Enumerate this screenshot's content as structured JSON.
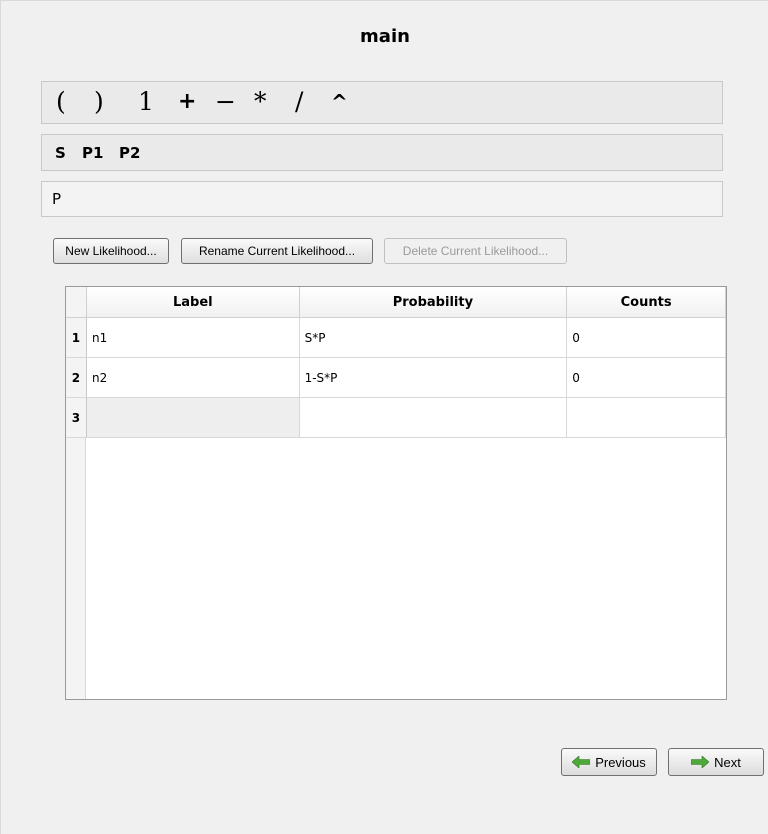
{
  "title": "main",
  "operators": [
    "(",
    ")",
    "1",
    "+",
    "−",
    "*",
    "/",
    "^"
  ],
  "parameters": [
    "S",
    "P1",
    "P2"
  ],
  "expression": "P",
  "buttons": {
    "new_likelihood": "New Likelihood...",
    "rename_likelihood": "Rename Current Likelihood...",
    "delete_likelihood": "Delete Current Likelihood..."
  },
  "table": {
    "headers": [
      "Label",
      "Probability",
      "Counts"
    ],
    "rows": [
      {
        "num": "1",
        "label": "n1",
        "probability": "S*P",
        "counts": "0"
      },
      {
        "num": "2",
        "label": "n2",
        "probability": "1-S*P",
        "counts": "0"
      },
      {
        "num": "3",
        "label": "",
        "probability": "",
        "counts": ""
      }
    ]
  },
  "nav": {
    "previous": "Previous",
    "next": "Next"
  },
  "colors": {
    "arrow": "#4fa83a"
  },
  "icons": {
    "previous": "arrow-left-icon",
    "next": "arrow-right-icon"
  }
}
